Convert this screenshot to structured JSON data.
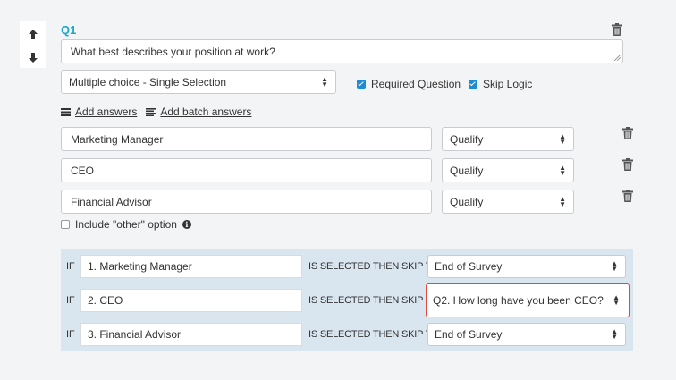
{
  "question": {
    "number": "Q1",
    "text": "What best describes your position at work?",
    "type_select": "Multiple choice - Single Selection",
    "required_label": "Required Question",
    "skip_logic_label": "Skip Logic"
  },
  "links": {
    "add_answers": "Add answers",
    "add_batch_answers": "Add batch answers"
  },
  "answers": [
    {
      "text": "Marketing Manager",
      "action": "Qualify"
    },
    {
      "text": "CEO",
      "action": "Qualify"
    },
    {
      "text": "Financial Advisor",
      "action": "Qualify"
    }
  ],
  "other_option_label": "Include \"other\" option",
  "skip_rules": {
    "if_label": "IF",
    "condition_label": "IS SELECTED THEN SKIP TO",
    "rows": [
      {
        "answer": "1. Marketing Manager",
        "target": "End of Survey"
      },
      {
        "answer": "2. CEO",
        "target": "Q2. How long have you been CEO?"
      },
      {
        "answer": "3. Financial Advisor",
        "target": "End of Survey"
      }
    ]
  },
  "colors": {
    "accent": "#1aa7c7",
    "checkbox": "#1a8cd8",
    "highlight": "#e04a3c",
    "skip_panel": "#d9e6ef"
  },
  "icons": {
    "move_up": "arrow-up-icon",
    "move_down": "arrow-down-icon",
    "delete": "trash-icon",
    "list": "list-icon",
    "batch": "lines-icon",
    "info": "info-icon"
  }
}
